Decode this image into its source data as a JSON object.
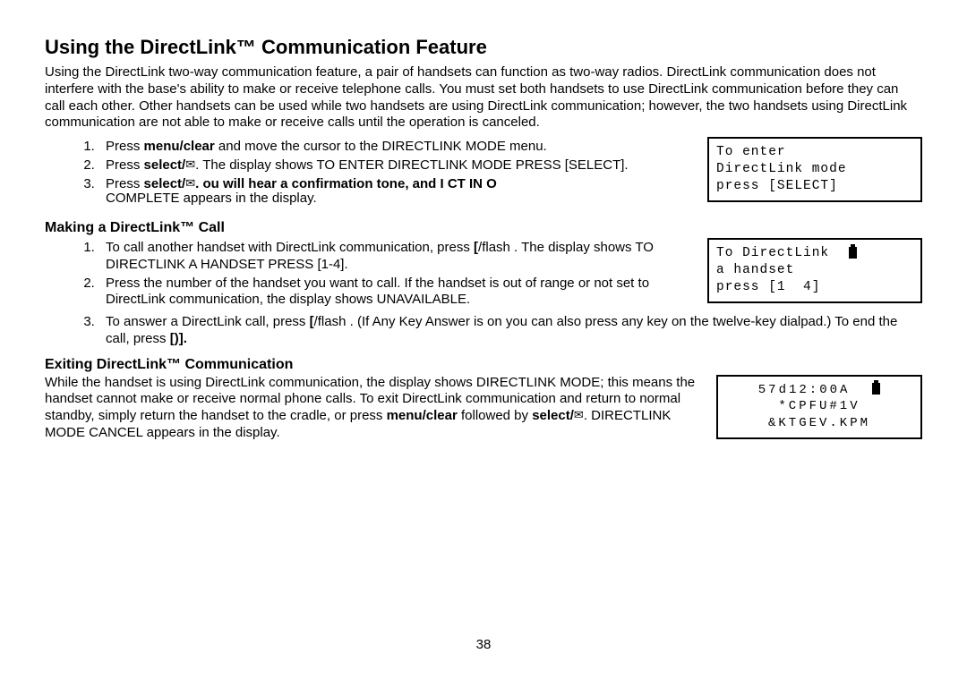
{
  "title": "Using the DirectLink™ Communication Feature",
  "intro": "Using the DirectLink two-way communication feature, a pair of handsets can function as two-way radios. DirectLink communication does not interfere with the base's ability to make or receive telephone calls. You must set both handsets to use DirectLink communication before they can call each other. Other handsets can be used while two handsets are using DirectLink communication; however, the two handsets using DirectLink communication are not able to make or receive calls until the operation is canceled.",
  "setup_steps": {
    "s1_a": "Press ",
    "s1_b": "menu/clear",
    "s1_c": " and move the cursor to the DIRECTLINK MODE menu.",
    "s2_a": "Press ",
    "s2_b": "select/",
    "s2_c": ". The display shows TO ENTER DIRECTLINK MODE PRESS [SELECT].",
    "s3_a": "Press ",
    "s3_b": "select/",
    "s3_c": ".    ou will hear a confirmation tone, and    I     CT   IN      O",
    "s3_d": "COMPLETE appears in the display."
  },
  "lcd1": {
    "l1": "To enter",
    "l2": "DirectLink mode",
    "l3": "press [SELECT]"
  },
  "make_heading": "Making a DirectLink™ Call",
  "make_steps": {
    "s1_a": "To call another handset with DirectLink communication, press ",
    "s1_b": "/flash",
    "s1_c": " . The display shows TO DIRECTLINK A HANDSET PRESS [1-4].",
    "s2": "Press the number of the handset you want to call. If the handset is out of range or not set to DirectLink communication, the display shows UNAVAILABLE.",
    "s3_a": "To answer a DirectLink call, press ",
    "s3_b": "/flash",
    "s3_c": " . (If Any Key Answer is on you can also press any key on the twelve-key dialpad.) To end the call, press ",
    "s3_d": "[",
    "s3_e": "]."
  },
  "lcd2": {
    "l1_a": "To DirectLink  ",
    "l2": "a handset",
    "l3": "press [1  4]"
  },
  "exit_heading": "Exiting DirectLink™ Communication",
  "exit_body_a": "While the handset is using DirectLink communication, the display shows DIRECTLINK MODE; this means the handset cannot make or receive normal phone calls. To exit DirectLink communication and return to normal standby, simply return the handset to the cradle, or press ",
  "exit_body_b": "menu/clear",
  "exit_body_c": " followed by ",
  "exit_body_d": "select/",
  "exit_body_e": ". DIRECTLINK MODE CANCEL appears in the display.",
  "lcd3": {
    "l1": "57d12:00A  ",
    "l2": "*CPFU#1V",
    "l3": "&KTGEV.KPM"
  },
  "page_number": "38"
}
